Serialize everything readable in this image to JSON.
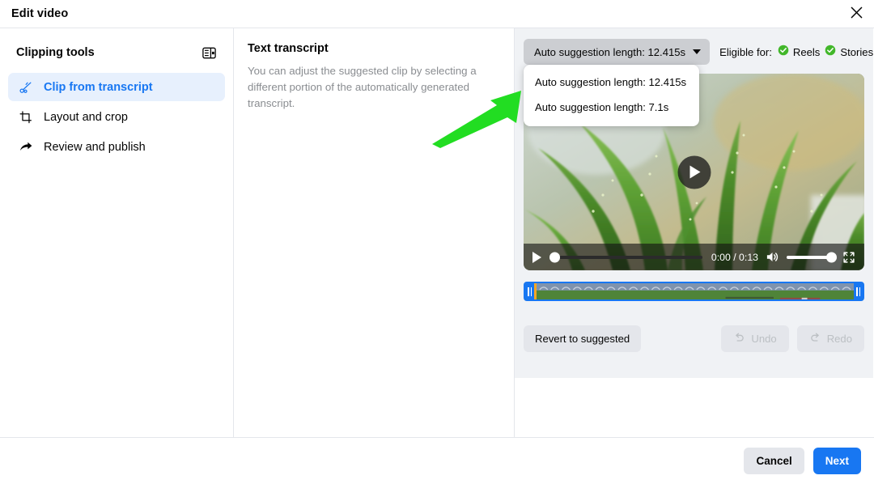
{
  "header": {
    "title": "Edit video",
    "close_icon": "close-icon"
  },
  "sidebar": {
    "title": "Clipping tools",
    "panel_toggle_icon": "layout-panel-icon",
    "items": [
      {
        "label": "Clip from transcript",
        "icon": "scissors-icon",
        "active": true
      },
      {
        "label": "Layout and crop",
        "icon": "crop-icon",
        "active": false
      },
      {
        "label": "Review and publish",
        "icon": "share-arrow-icon",
        "active": false
      }
    ]
  },
  "transcript": {
    "title": "Text transcript",
    "description": "You can adjust the suggested clip by selecting a different portion of the automatically generated transcript."
  },
  "preview": {
    "suggestion_select": {
      "label": "Auto suggestion length: 12.415s",
      "caret_icon": "chevron-down-icon",
      "expanded": true,
      "options": [
        "Auto suggestion length: 12.415s",
        "Auto suggestion length: 7.1s"
      ]
    },
    "eligible": {
      "label": "Eligible for:",
      "badges": [
        {
          "name": "Reels",
          "icon": "check-circle-icon",
          "color": "#42b72a"
        },
        {
          "name": "Stories",
          "icon": "check-circle-icon",
          "color": "#42b72a"
        }
      ]
    },
    "video": {
      "play_overlay_icon": "play-circle-icon",
      "controls": {
        "play_icon": "play-icon",
        "current_time": "0:00",
        "separator": "/",
        "duration": "0:13",
        "time_display": "0:00 / 0:13",
        "volume_icon": "volume-icon",
        "volume_level": 100,
        "fullscreen_icon": "fullscreen-icon",
        "progress": 0
      }
    },
    "timeline": {
      "left_handle_icon": "trim-handle-icon",
      "right_handle_icon": "trim-handle-icon",
      "playhead_position_pct": 3,
      "accent_color": "#1877f2",
      "playhead_color": "#f5a623"
    },
    "actions": {
      "revert_label": "Revert to suggested",
      "undo_label": "Undo",
      "undo_icon": "undo-icon",
      "undo_disabled": true,
      "redo_label": "Redo",
      "redo_icon": "redo-icon",
      "redo_disabled": true
    }
  },
  "footer": {
    "cancel_label": "Cancel",
    "next_label": "Next",
    "primary_color": "#1877f2"
  },
  "annotation": {
    "arrow_color": "#22dd22",
    "arrow_icon": "pointer-arrow-icon"
  }
}
